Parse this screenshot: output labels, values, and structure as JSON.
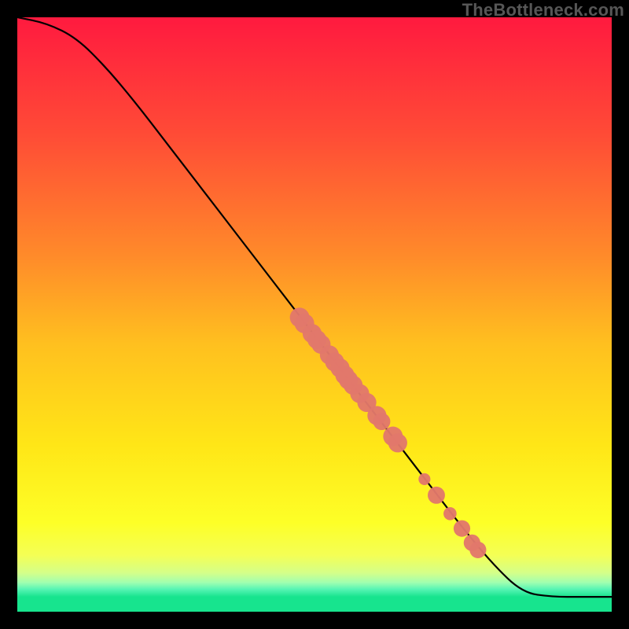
{
  "watermark": "TheBottleneck.com",
  "chart_data": {
    "type": "line",
    "title": "",
    "xlabel": "",
    "ylabel": "",
    "xlim": [
      0,
      100
    ],
    "ylim": [
      0,
      100
    ],
    "grid": false,
    "series": [
      {
        "name": "curve",
        "x": [
          0,
          5,
          10,
          15,
          20,
          25,
          30,
          35,
          40,
          45,
          50,
          55,
          60,
          65,
          70,
          75,
          80,
          85,
          90,
          95,
          100
        ],
        "y": [
          100,
          99,
          96.5,
          91.5,
          85.5,
          79,
          72.5,
          66,
          59.5,
          53,
          46.5,
          40,
          33.5,
          27,
          20.5,
          14,
          8,
          3.2,
          2.5,
          2.5,
          2.5
        ]
      }
    ],
    "scatter": {
      "name": "hotspots",
      "points": [
        {
          "x": 47.5,
          "y": 49.5,
          "r": 1.65
        },
        {
          "x": 48.3,
          "y": 48.5,
          "r": 1.65
        },
        {
          "x": 49.6,
          "y": 46.8,
          "r": 1.6
        },
        {
          "x": 50.4,
          "y": 45.8,
          "r": 1.6
        },
        {
          "x": 51.1,
          "y": 45.0,
          "r": 1.6
        },
        {
          "x": 52.5,
          "y": 43.2,
          "r": 1.6
        },
        {
          "x": 53.4,
          "y": 42.0,
          "r": 1.6
        },
        {
          "x": 54.3,
          "y": 41.0,
          "r": 1.6
        },
        {
          "x": 55.1,
          "y": 39.8,
          "r": 1.6
        },
        {
          "x": 55.7,
          "y": 39.0,
          "r": 1.6
        },
        {
          "x": 56.5,
          "y": 38.1,
          "r": 1.6
        },
        {
          "x": 57.6,
          "y": 36.7,
          "r": 1.6
        },
        {
          "x": 58.8,
          "y": 35.2,
          "r": 1.6
        },
        {
          "x": 60.5,
          "y": 33.0,
          "r": 1.6
        },
        {
          "x": 61.3,
          "y": 32.0,
          "r": 1.45
        },
        {
          "x": 63.2,
          "y": 29.5,
          "r": 1.65
        },
        {
          "x": 64.0,
          "y": 28.4,
          "r": 1.6
        },
        {
          "x": 68.5,
          "y": 22.3,
          "r": 1.0
        },
        {
          "x": 70.5,
          "y": 19.6,
          "r": 1.45
        },
        {
          "x": 72.8,
          "y": 16.5,
          "r": 1.1
        },
        {
          "x": 74.8,
          "y": 14.0,
          "r": 1.4
        },
        {
          "x": 76.5,
          "y": 11.6,
          "r": 1.4
        },
        {
          "x": 77.5,
          "y": 10.4,
          "r": 1.4
        }
      ]
    },
    "background_gradient": {
      "type": "vertical-multi",
      "stops": [
        {
          "pos": 0.0,
          "color": "#ff1a3f"
        },
        {
          "pos": 0.2,
          "color": "#ff4c36"
        },
        {
          "pos": 0.4,
          "color": "#ff8a2a"
        },
        {
          "pos": 0.55,
          "color": "#ffc01f"
        },
        {
          "pos": 0.72,
          "color": "#ffe617"
        },
        {
          "pos": 0.85,
          "color": "#fdff27"
        },
        {
          "pos": 0.905,
          "color": "#f4ff55"
        },
        {
          "pos": 0.935,
          "color": "#d4ff8a"
        },
        {
          "pos": 0.951,
          "color": "#a0ffb0"
        },
        {
          "pos": 0.962,
          "color": "#58f5b4"
        },
        {
          "pos": 0.975,
          "color": "#17e48e"
        },
        {
          "pos": 1.0,
          "color": "#17e48e"
        }
      ]
    }
  }
}
